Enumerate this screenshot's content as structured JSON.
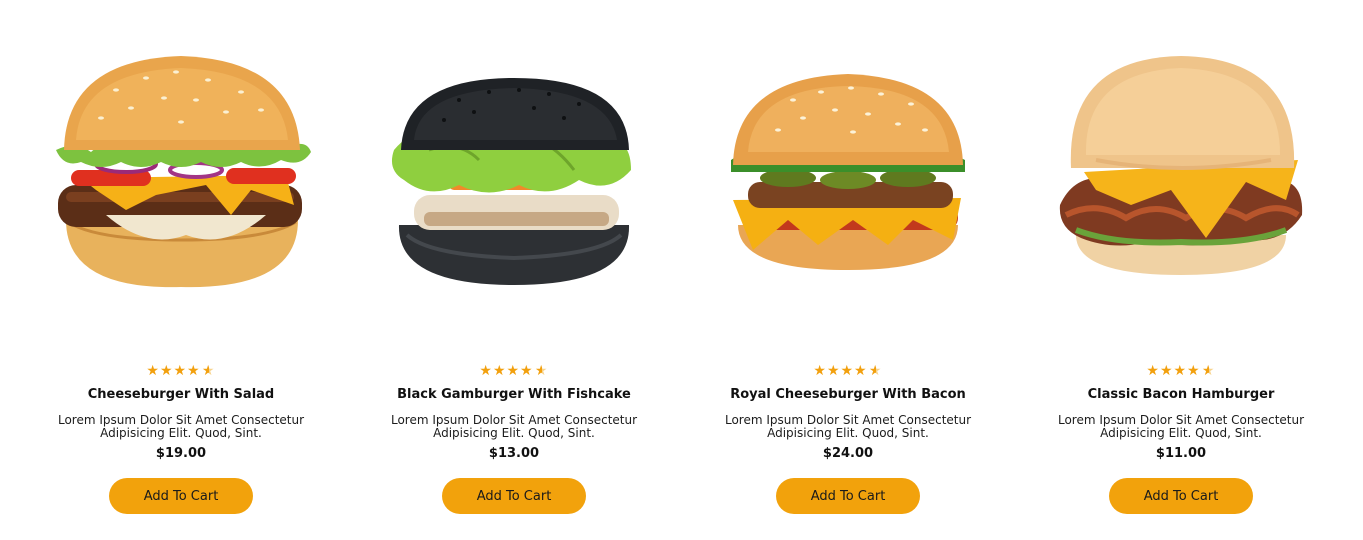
{
  "accent_color": "#f2a20c",
  "star_color": "#f2a00e",
  "products": [
    {
      "name": "Cheeseburger With Salad",
      "description": "Lorem Ipsum Dolor Sit Amet Consectetur Adipisicing Elit. Quod, Sint.",
      "price": "$19.00",
      "rating": 4.5,
      "stars": "★★★★",
      "cart_label": "Add To Cart",
      "image": "burger-with-salad-image"
    },
    {
      "name": "Black Gamburger With Fishcake",
      "description": "Lorem Ipsum Dolor Sit Amet Consectetur Adipisicing Elit. Quod, Sint.",
      "price": "$13.00",
      "rating": 4.5,
      "stars": "★★★★",
      "cart_label": "Add To Cart",
      "image": "black-bun-burger-image"
    },
    {
      "name": "Royal Cheeseburger With Bacon",
      "description": "Lorem Ipsum Dolor Sit Amet Consectetur Adipisicing Elit. Quod, Sint.",
      "price": "$24.00",
      "rating": 4.5,
      "stars": "★★★★",
      "cart_label": "Add To Cart",
      "image": "royal-cheeseburger-image"
    },
    {
      "name": "Classic Bacon Hamburger",
      "description": "Lorem Ipsum Dolor Sit Amet Consectetur Adipisicing Elit. Quod, Sint.",
      "price": "$11.00",
      "rating": 4.5,
      "stars": "★★★★",
      "cart_label": "Add To Cart",
      "image": "bacon-hamburger-image"
    }
  ]
}
